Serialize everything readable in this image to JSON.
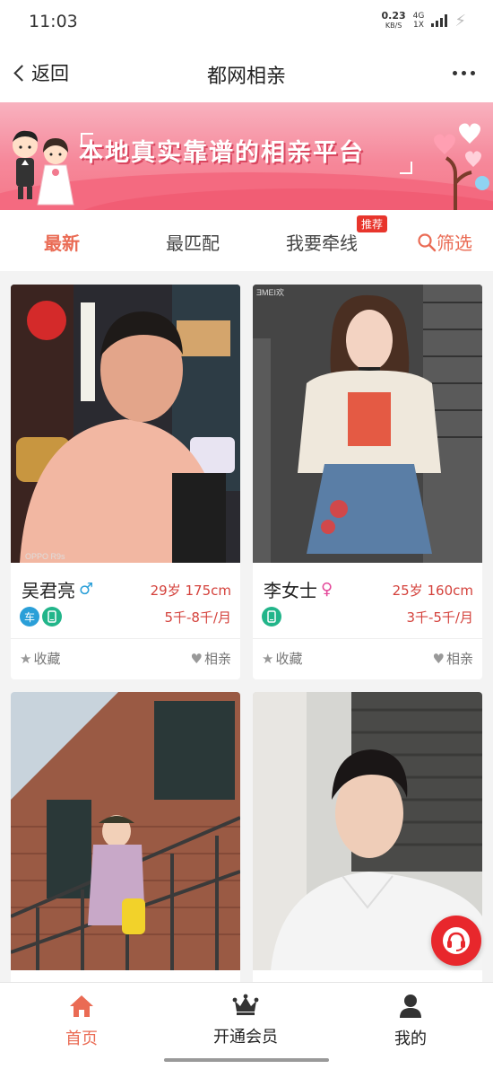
{
  "status_bar": {
    "time": "11:03",
    "net_speed": "0.23",
    "net_unit": "KB/S",
    "network": "4G",
    "sim": "1X"
  },
  "nav": {
    "back_label": "返回",
    "title": "都网相亲"
  },
  "banner": {
    "text": "本地真实靠谱的相亲平台"
  },
  "tabs": [
    {
      "label": "最新",
      "active": true
    },
    {
      "label": "最匹配",
      "active": false
    },
    {
      "label": "我要牵线",
      "active": false,
      "badge": "推荐"
    }
  ],
  "filter_label": "筛选",
  "cards": [
    {
      "name": "吴君亮",
      "gender_symbol": "♂",
      "age_height": "29岁 175cm",
      "badges": [
        "车",
        "phone-icon"
      ],
      "salary": "5千-8千/月",
      "favorite_label": "收藏",
      "date_label": "相亲",
      "photo_watermark": "OPPO R9s"
    },
    {
      "name": "李女士",
      "gender_symbol": "♀",
      "age_height": "25岁 160cm",
      "badges": [
        "phone-icon"
      ],
      "salary": "3千-5千/月",
      "favorite_label": "收藏",
      "date_label": "相亲"
    },
    {},
    {}
  ],
  "bottom_nav": [
    {
      "label": "首页",
      "icon": "home-icon",
      "active": true
    },
    {
      "label": "开通会员",
      "icon": "crown-icon",
      "active": false
    },
    {
      "label": "我的",
      "icon": "user-icon",
      "active": false
    }
  ],
  "colors": {
    "accent": "#ea6b54",
    "price_red": "#d4423c",
    "banner_pink": "#f6889a",
    "badge_blue": "#2a9fd8",
    "badge_green": "#22b58a",
    "male_blue": "#2a9fd8",
    "female_pink": "#e4489a"
  }
}
